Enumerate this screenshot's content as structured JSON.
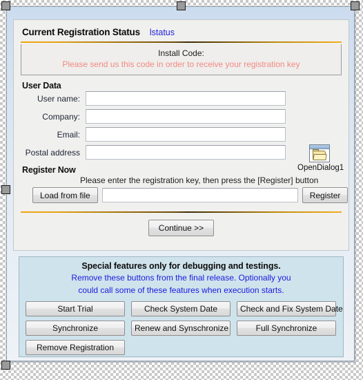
{
  "header": {
    "title": "Current Registration Status",
    "status_component": "lstatus"
  },
  "install_code": {
    "label": "Install Code:",
    "note": "Please send us this code in order to receive your registration key"
  },
  "user_data": {
    "caption": "User Data",
    "fields": [
      {
        "label": "User name:",
        "value": "",
        "placeholder": ""
      },
      {
        "label": "Company:",
        "value": "",
        "placeholder": ""
      },
      {
        "label": "Email:",
        "value": "",
        "placeholder": ""
      },
      {
        "label": "Postal address",
        "value": "",
        "placeholder": ""
      }
    ],
    "open_dialog": {
      "label": "OpenDialog1",
      "icon": "folder-open-dialog-icon"
    }
  },
  "register": {
    "caption": "Register Now",
    "hint": "Please enter the registration key, then press the [Register] button",
    "load_button": "Load from file",
    "key_value": "",
    "key_placeholder": "",
    "register_button": "Register"
  },
  "continue": {
    "label": "Continue >>"
  },
  "debug": {
    "title": "Special features only for debugging and testings.",
    "note_line1": "Remove these buttons from the final release. Optionally you",
    "note_line2": "could call some of these features when execution starts.",
    "buttons": [
      "Start Trial",
      "Check System Date",
      "Check and Fix System Date",
      "Synchronize",
      "Renew and Synschronize",
      "Full Synchronize",
      "Remove Registration"
    ]
  },
  "colors": {
    "accent_gold": "#e8a411",
    "note_red": "#f2897e",
    "link_blue": "#2222dd",
    "debug_blue": "#1a1ae0",
    "debug_panel_bg": "#cfe3ec"
  }
}
